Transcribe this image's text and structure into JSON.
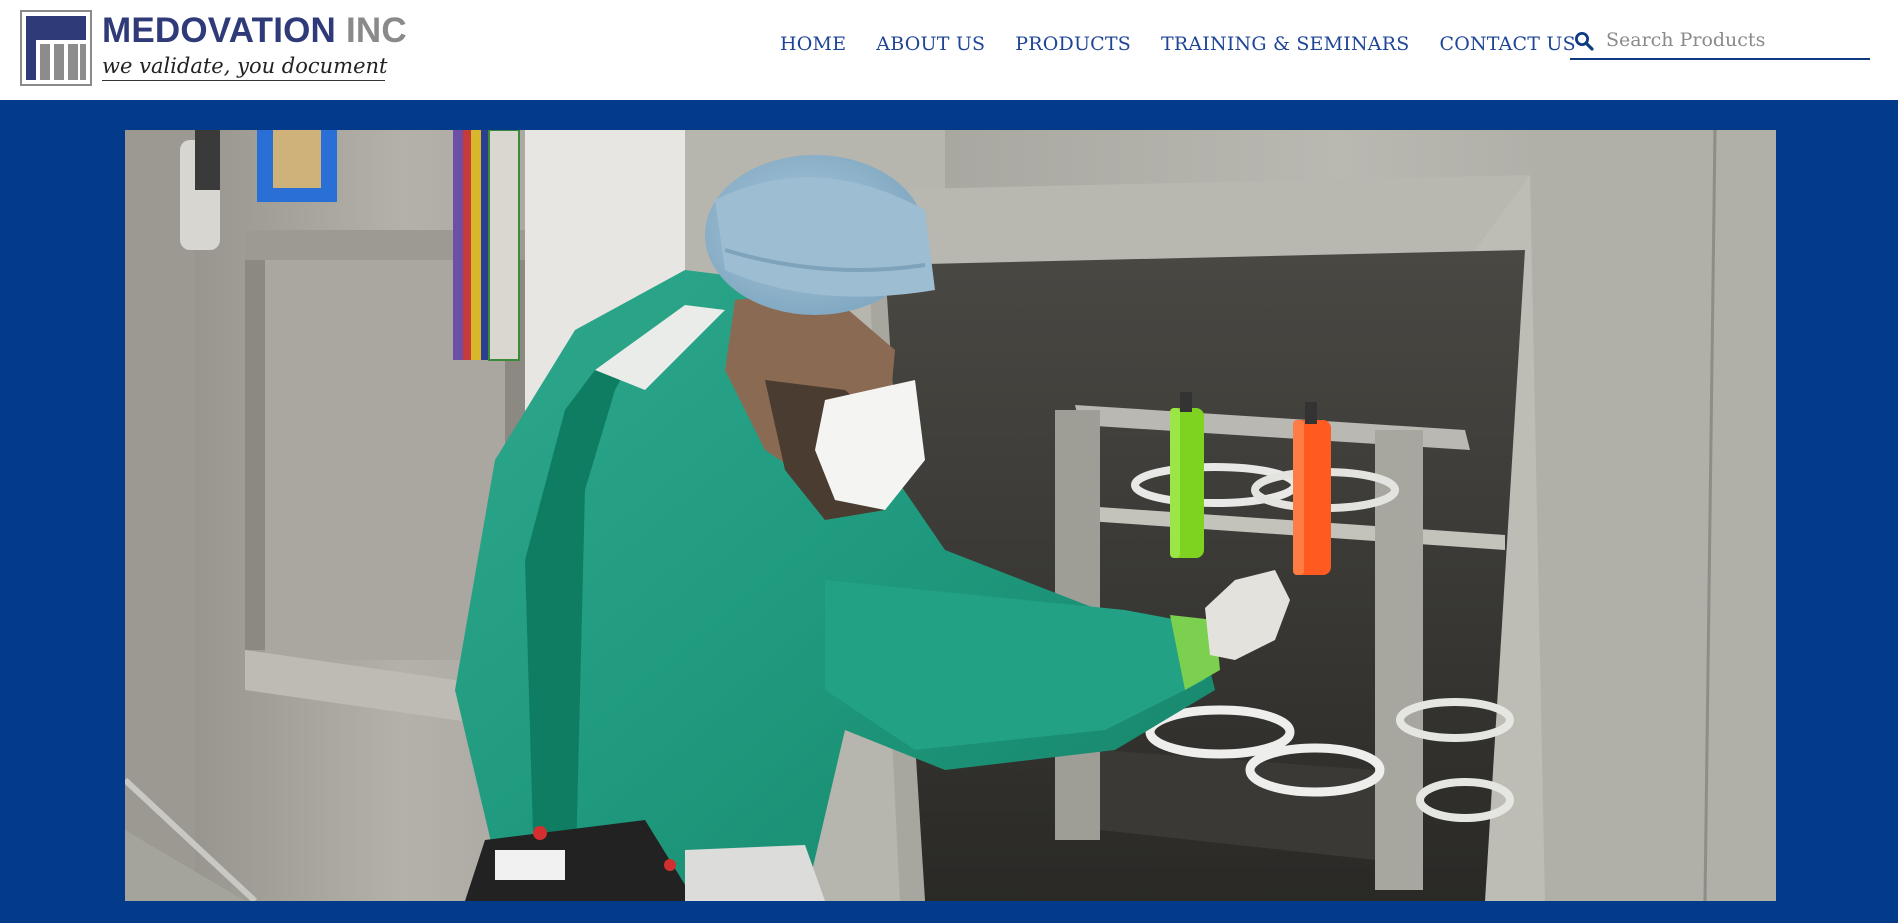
{
  "brand": {
    "name": "MEDOVATION",
    "suffix": "INC",
    "tagline": "we validate, you document",
    "colors": {
      "navy": "#2f3a78",
      "gray": "#8a8a8a"
    }
  },
  "nav": {
    "items": [
      {
        "label": "HOME"
      },
      {
        "label": "ABOUT US"
      },
      {
        "label": "PRODUCTS"
      },
      {
        "label": "TRAINING & SEMINARS"
      },
      {
        "label": "CONTACT US"
      }
    ],
    "color": "#1f4597"
  },
  "search": {
    "icon": "search-icon",
    "placeholder": "Search Products",
    "value": ""
  },
  "hero": {
    "background": "#043a8a",
    "image_alt": "Technician in green gown and hair net placing colored indicator tubes into a stainless steel sterilizer chamber"
  }
}
